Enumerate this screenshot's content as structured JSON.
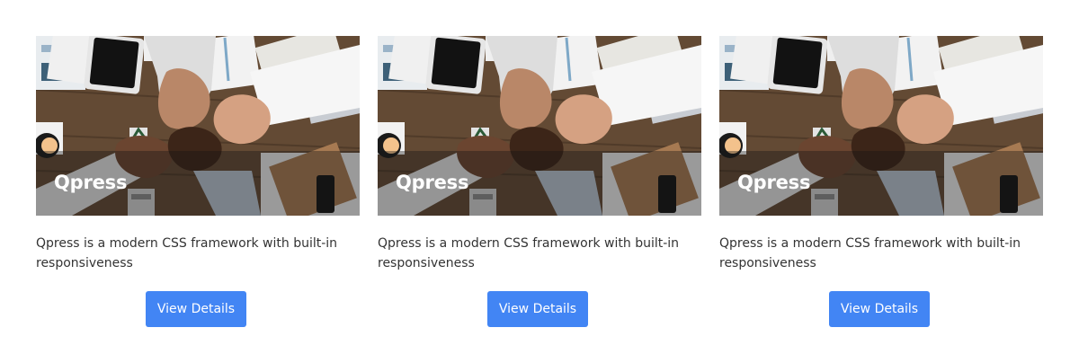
{
  "cards": [
    {
      "title": "Qpress",
      "description": "Qpress is a modern CSS framework with built-in responsiveness",
      "button_label": "View Details",
      "image_subject": "team-fist-bump-on-desk"
    },
    {
      "title": "Qpress",
      "description": "Qpress is a modern CSS framework with built-in responsiveness",
      "button_label": "View Details",
      "image_subject": "team-fist-bump-on-desk"
    },
    {
      "title": "Qpress",
      "description": "Qpress is a modern CSS framework with built-in responsiveness",
      "button_label": "View Details",
      "image_subject": "team-fist-bump-on-desk"
    }
  ],
  "colors": {
    "button_background": "#4285f4",
    "button_text": "#ffffff",
    "description_text": "#333333",
    "page_background": "#ffffff"
  }
}
